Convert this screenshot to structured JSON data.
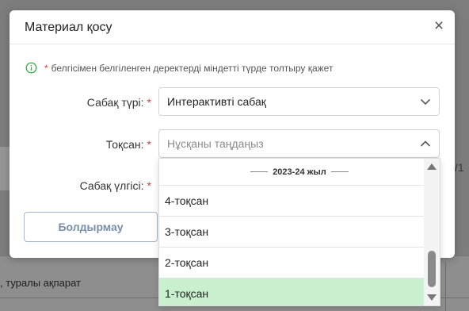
{
  "background": {
    "row_text": ", туралы ақпарат",
    "right_fragment": "/1"
  },
  "modal": {
    "title": "Материал қосу",
    "close_glyph": "×",
    "notice": {
      "icon": "info-circle-icon",
      "star": "*",
      "text": "белгісімен белгіленген деректерді міндетті түрде толтыру қажет"
    },
    "fields": {
      "lesson_type": {
        "label": "Сабақ түрі:",
        "required_mark": "*",
        "value": "Интерактивті сабақ"
      },
      "quarter": {
        "label": "Тоқсан:",
        "required_mark": "*",
        "placeholder": "Нұсқаны таңдаңыз"
      },
      "lesson_template": {
        "label": "Сабақ үлгісі:",
        "required_mark": "*"
      }
    },
    "cancel_label": "Болдырмау"
  },
  "dropdown": {
    "group_label": "2023-24 жыл",
    "options": [
      "4-тоқсан",
      "3-тоқсан",
      "2-тоқсан",
      "1-тоқсан"
    ],
    "selected": "1-тоқсан"
  },
  "colors": {
    "required": "#e03b3b",
    "info_icon": "#2eaa3f",
    "selected_option_bg": "#c8f0cf",
    "cancel_text": "#7a8ea9"
  }
}
